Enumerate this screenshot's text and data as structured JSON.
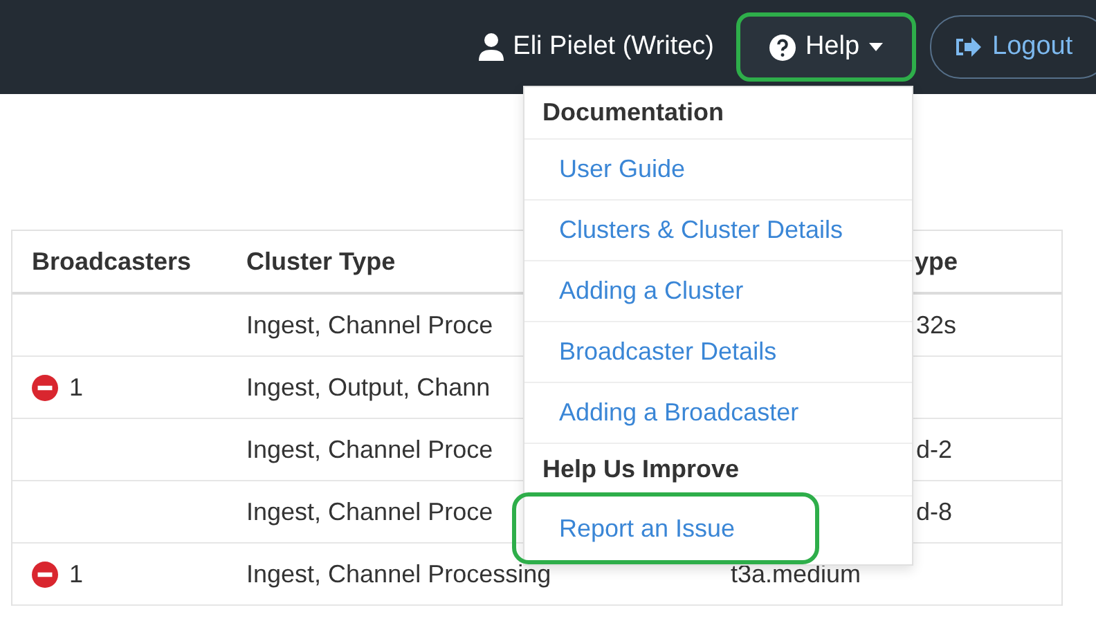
{
  "navbar": {
    "user": "Eli Pielet (Writec)",
    "help": {
      "label": "Help",
      "highlighted": true
    },
    "logout": "Logout"
  },
  "help_menu": [
    {
      "kind": "header",
      "label": "Documentation"
    },
    {
      "kind": "link",
      "label": "User Guide",
      "highlighted": false
    },
    {
      "kind": "link",
      "label": "Clusters & Cluster Details",
      "highlighted": false
    },
    {
      "kind": "link",
      "label": "Adding a Cluster",
      "highlighted": false
    },
    {
      "kind": "link",
      "label": "Broadcaster Details",
      "highlighted": false
    },
    {
      "kind": "link",
      "label": "Adding a Broadcaster",
      "highlighted": false
    },
    {
      "kind": "header",
      "label": "Help Us Improve"
    },
    {
      "kind": "link",
      "label": "Report an Issue",
      "highlighted": true
    }
  ],
  "table": {
    "columns": [
      {
        "label": "Broadcasters"
      },
      {
        "label": "Cluster Type"
      },
      {
        "label": "ype",
        "clipped": true
      }
    ],
    "rows": [
      {
        "cluster_type": "Ingest, Channel Proce",
        "column_3": "32s",
        "clipped": true
      },
      {
        "broadcasters": "1",
        "error": true,
        "cluster_type": "Ingest, Output, Chann"
      },
      {
        "cluster_type": "Ingest, Channel Proce",
        "column_3": "d-2",
        "clipped": true
      },
      {
        "cluster_type": "Ingest, Channel Proce",
        "column_3": "d-8",
        "clipped": true
      },
      {
        "broadcasters": "1",
        "error": true,
        "cluster_type": "Ingest, Channel Processing",
        "column_3": "t3a.medium",
        "clipped": false
      }
    ]
  }
}
